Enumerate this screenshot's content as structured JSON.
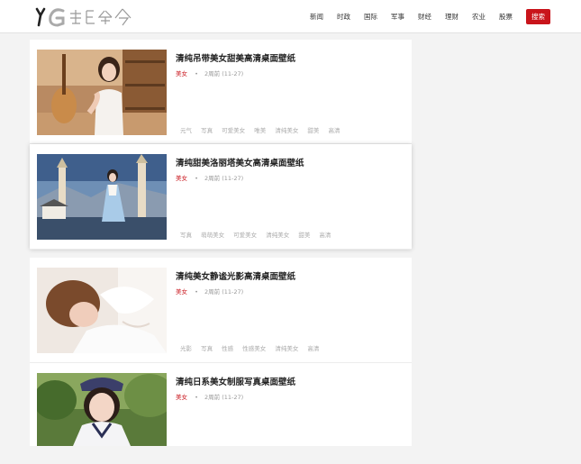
{
  "header": {
    "nav": [
      "新闻",
      "时政",
      "国际",
      "军事",
      "财经",
      "理财",
      "农业",
      "股票"
    ],
    "search_label": "搜索"
  },
  "articles": [
    {
      "title": "清纯吊带美女甜美高清桌面壁纸",
      "category": "美女",
      "time": "2周前 (11-27)",
      "tags": [
        "元气",
        "写真",
        "可爱美女",
        "唯美",
        "清纯美女",
        "甜美",
        "高清"
      ]
    },
    {
      "title": "清纯甜美洛丽塔美女高清桌面壁纸",
      "category": "美女",
      "time": "2周前 (11-27)",
      "tags": [
        "写真",
        "萌萌美女",
        "可爱美女",
        "清纯美女",
        "甜美",
        "高清"
      ]
    },
    {
      "title": "清纯美女静谧光影高清桌面壁纸",
      "category": "美女",
      "time": "2周前 (11-27)",
      "tags": [
        "光影",
        "写真",
        "性感",
        "性感美女",
        "清纯美女",
        "高清"
      ]
    },
    {
      "title": "清纯日系美女制服写真桌面壁纸",
      "category": "美女",
      "time": "2周前 (11-27)",
      "tags": []
    }
  ]
}
